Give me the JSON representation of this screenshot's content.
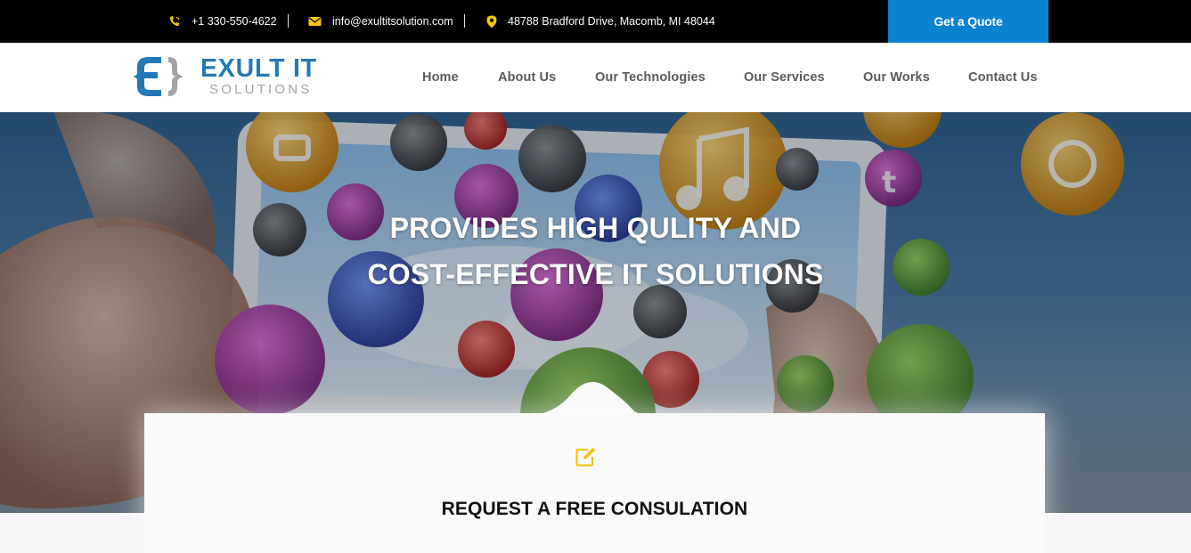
{
  "topbar": {
    "phone": "+1 330-550-4622",
    "email": "info@exultitsolution.com",
    "address": "48788 Bradford Drive, Macomb, MI 48044",
    "quote_button": "Get a Quote",
    "icons": {
      "phone": "phone-icon",
      "email": "envelope-icon",
      "address": "map-pin-icon"
    },
    "icon_color": "#f5c518",
    "button_color": "#0a82d0"
  },
  "brand": {
    "name": "EXULT IT",
    "tagline": "SOLUTIONS",
    "primary_color": "#2479b5",
    "secondary_color": "#a0a3a8"
  },
  "nav": {
    "items": [
      "Home",
      "About Us",
      "Our Technologies",
      "Our Services",
      "Our Works",
      "Contact Us"
    ]
  },
  "hero": {
    "line1": "PROVIDES HIGH QULITY AND",
    "line2": "COST-EFFECTIVE IT SOLUTIONS"
  },
  "consultation": {
    "icon": "edit-icon",
    "title": "REQUEST A FREE CONSULATION"
  }
}
